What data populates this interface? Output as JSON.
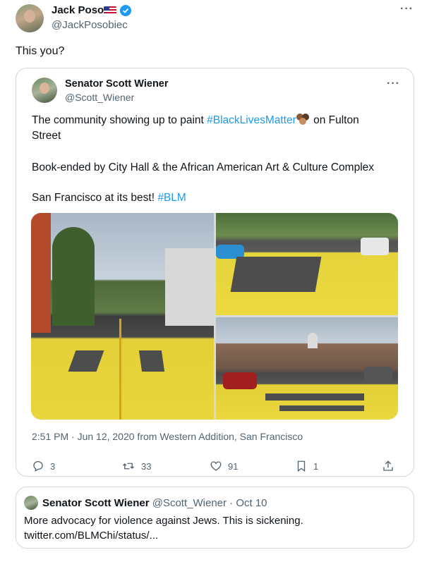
{
  "author": {
    "name": "Jack Poso",
    "handle": "@JackPosobiec"
  },
  "tweet": {
    "text": "This you?"
  },
  "quoted_tweet": {
    "name": "Senator Scott Wiener",
    "handle": "@Scott_Wiener",
    "line1_prefix": "The community showing up to paint ",
    "line1_hashtag": "#BlackLivesMatter",
    "line1_suffix": " on Fulton",
    "line2": "Street",
    "paragraph2": "Book-ended by City Hall & the African American Art & Culture Complex",
    "paragraph3_prefix": "San Francisco at its best! ",
    "paragraph3_hashtag": "#BLM",
    "timestamp": "2:51 PM · Jun 12, 2020 from Western Addition, San Francisco",
    "actions": {
      "replies": "3",
      "retweets": "33",
      "likes": "91",
      "bookmarks": "1"
    }
  },
  "second_quote": {
    "name": "Senator Scott Wiener",
    "handle_date": "@Scott_Wiener · Oct 10",
    "line1": "More advocacy for violence against Jews. This is sickening.",
    "line2": "twitter.com/BLMChi/status/..."
  },
  "colors": {
    "link": "#1d9bf0",
    "secondary_text": "#536471",
    "border": "#cfd9de",
    "verified": "#1d9bf0"
  }
}
